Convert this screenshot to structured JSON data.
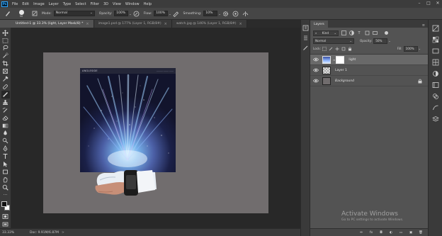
{
  "app": {
    "logo": "Ps"
  },
  "menubar": {
    "items": [
      "File",
      "Edit",
      "Image",
      "Layer",
      "Type",
      "Select",
      "Filter",
      "3D",
      "View",
      "Window",
      "Help"
    ],
    "window_controls": [
      "–",
      "□",
      "✕"
    ]
  },
  "options_bar": {
    "brush_size": "50",
    "mode_label": "Mode:",
    "mode_value": "Normal",
    "opacity_label": "Opacity:",
    "opacity_value": "100%",
    "flow_label": "Flow:",
    "flow_value": "100%",
    "smoothing_label": "Smoothing:",
    "smoothing_value": "10%"
  },
  "tabs": [
    {
      "label": "Untitled-1 @ 33.3% (light, Layer Mask/8) *",
      "close": "×"
    },
    {
      "label": "image1.psd @ 177% (Layer 1, RGB/8#)",
      "close": "×"
    },
    {
      "label": "watch.jpg @ 146% (Layer 1, RGB/8#)",
      "close": "×"
    }
  ],
  "poster": {
    "logo": "ANGLESIDE",
    "nav": "────── ───── ────"
  },
  "status": {
    "zoom": "33.33%",
    "doc": "Doc: 9.91M/6.87M",
    "arrow": ">"
  },
  "layers_panel": {
    "tab": "Layers",
    "menu": "≡",
    "kind_label": "Kind",
    "blend_mode": "Normal",
    "opacity_label": "Opacity:",
    "opacity_value": "50%",
    "lock_label": "Lock:",
    "fill_label": "Fill:",
    "fill_value": "100%",
    "layers": [
      {
        "name": "light",
        "selected": true
      },
      {
        "name": "Layer 1",
        "selected": false
      },
      {
        "name": "Background",
        "selected": false,
        "locked": true
      }
    ],
    "footer": [
      "⇔",
      "fx",
      "◘",
      "◐",
      "▭",
      "▣",
      "🗑"
    ]
  },
  "watermark": {
    "title": "Activate Windows",
    "subtitle": "Go to PC settings to activate Windows."
  },
  "colors": {
    "chrome_dark": "#3a3a3a",
    "panel": "#535353",
    "canvas_bg": "#282828",
    "document": "#716d6e",
    "selection": "#696969",
    "accent": "#31a8ff"
  }
}
